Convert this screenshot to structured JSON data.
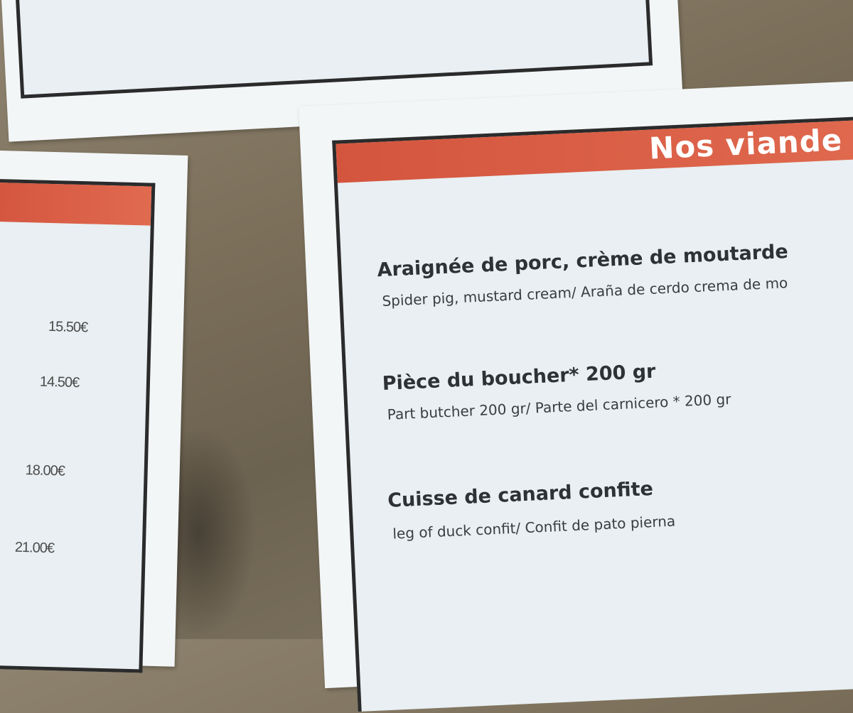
{
  "menu": {
    "section_title": "Nos viande",
    "dishes": [
      {
        "name": "Araignée de porc, crème de moutarde",
        "translation": "Spider pig, mustard cream/ Araña de cerdo crema de mo"
      },
      {
        "name": "Pièce du boucher* 200 gr",
        "translation": "Part butcher 200 gr/  Parte del carnicero * 200 gr"
      },
      {
        "name": "Cuisse de canard confite",
        "translation": "leg of duck confit/ Confit de pato pierna"
      }
    ]
  },
  "left_menu": {
    "prices": [
      "15.50€",
      "14.50€",
      "18.00€",
      "21.00€"
    ]
  },
  "colors": {
    "banner": "#d4553e",
    "paper": "#e9eff2",
    "border": "#2b2b2b"
  }
}
